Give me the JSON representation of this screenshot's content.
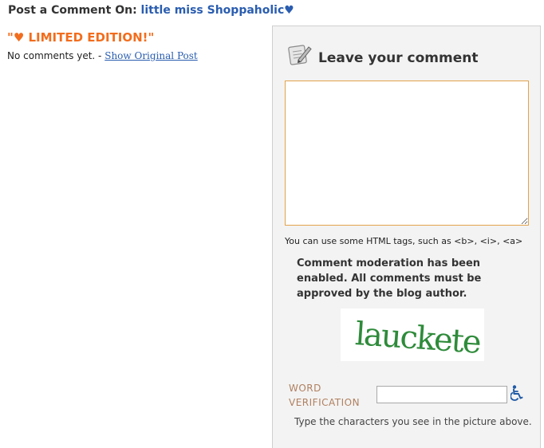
{
  "header": {
    "prefix": "Post a Comment On:",
    "blog_name": "little miss Shoppaholic♥"
  },
  "post": {
    "title": "\"♥ LIMITED EDITION!\"",
    "no_comments": "No comments yet.",
    "separator": "-",
    "show_original_label": "Show Original Post"
  },
  "comment_form": {
    "heading": "Leave your comment",
    "textarea_value": "",
    "html_hint": "You can use some HTML tags, such as <b>, <i>, <a>",
    "moderation_notice": "Comment moderation has been enabled. All comments must be approved by the blog author.",
    "captcha_text": "lauckete",
    "word_verification_label_line1": "WORD",
    "word_verification_label_line2": "VERIFICATION",
    "word_verification_value": "",
    "word_verification_hint": "Type the characters you see in the picture above.",
    "accessibility_icon": "wheelchair-icon",
    "heading_icon": "notepad-pencil-icon"
  },
  "colors": {
    "accent_orange": "#f26d1d",
    "link_blue": "#2a5db0",
    "textarea_focus_border": "#e2a34a",
    "captcha_green": "#2e8b3a",
    "label_brown": "#b08060"
  }
}
